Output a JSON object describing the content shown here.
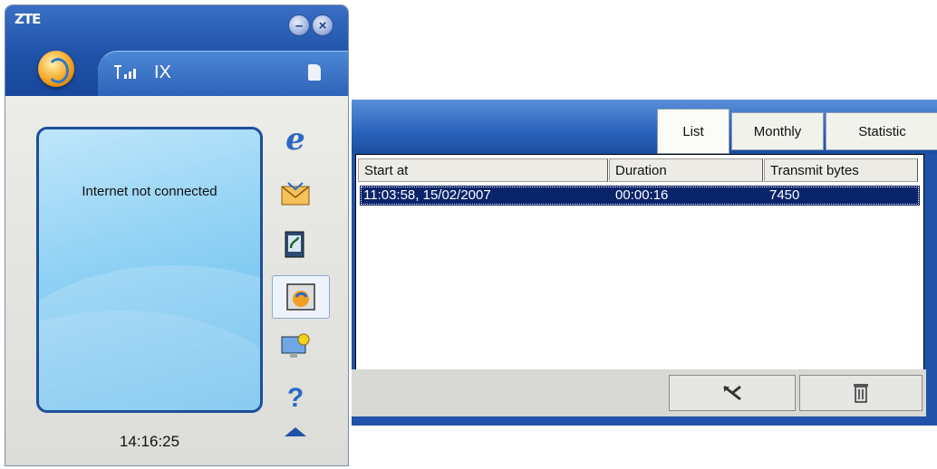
{
  "app": {
    "logo": "ZTE",
    "network": "IX",
    "connection_status": "Internet not connected",
    "clock": "14:16:25"
  },
  "stats": {
    "tabs": [
      "List",
      "Monthly",
      "Statistic"
    ],
    "selected_tab": "List",
    "columns": [
      "Start at",
      "Duration",
      "Transmit bytes"
    ],
    "rows": [
      {
        "start": "11:03:58, 15/02/2007",
        "duration": "00:00:16",
        "bytes": "7450"
      }
    ]
  },
  "icons": {
    "internet": "internet-explorer-icon",
    "sms": "sms-envelope-icon",
    "phonebook": "phonebook-icon",
    "statistics": "statistics-icon",
    "settings": "settings-icon",
    "help": "help-icon",
    "disconnect": "disconnect-icon",
    "delete": "trash-icon"
  },
  "colors": {
    "header_blue": "#1f52a8",
    "selection": "#0a246a",
    "screen_blue": "#8fd1f4"
  }
}
